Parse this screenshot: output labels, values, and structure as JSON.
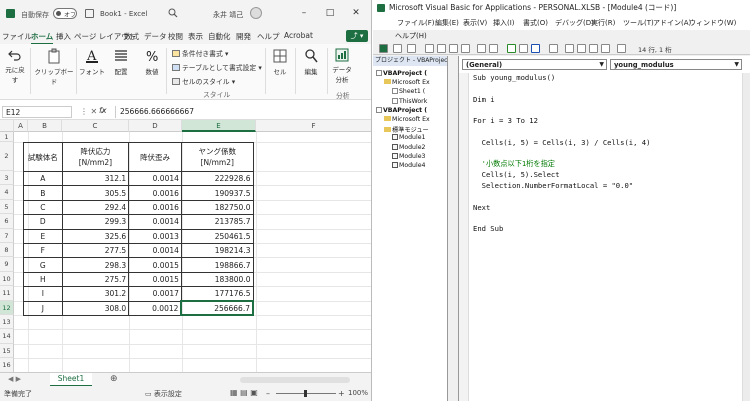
{
  "excel": {
    "autosave_label": "自動保存",
    "autosave_state": "オフ",
    "book_title": "Book1 - Excel",
    "user_name": "永井 靖己",
    "ribbon_tabs": [
      "ファイル",
      "ホーム",
      "挿入",
      "ページ レイアウト",
      "数式",
      "データ",
      "校閲",
      "表示",
      "自動化",
      "開発",
      "ヘルプ",
      "Acrobat"
    ],
    "active_tab": "ホーム",
    "ribbon": {
      "undo": "元に戻す",
      "clipboard": "クリップボード",
      "font": "フォント",
      "alignment": "配置",
      "number": "数値",
      "cond_format": "条件付き書式",
      "table_format": "テーブルとして書式設定",
      "cell_styles": "セルのスタイル",
      "styles_group": "スタイル",
      "cells": "セル",
      "editing": "編集",
      "analyze": "データ分析",
      "analyze_short": "分析"
    },
    "name_box": "E12",
    "formula": "256666.666666667",
    "columns": [
      "A",
      "B",
      "C",
      "D",
      "E",
      "F"
    ],
    "selected_column": "E",
    "row_numbers": [
      "1",
      "2",
      "3",
      "4",
      "5",
      "6",
      "7",
      "8",
      "9",
      "10",
      "11",
      "12",
      "13",
      "14",
      "15",
      "16"
    ],
    "selected_row": "12",
    "table": {
      "headers": [
        [
          "試験体名"
        ],
        [
          "降伏応力",
          "[N/mm2]"
        ],
        [
          "降伏歪み"
        ],
        [
          "ヤング係数",
          "[N/mm2]"
        ]
      ],
      "rows": [
        [
          "A",
          "312.1",
          "0.0014",
          "222928.6"
        ],
        [
          "B",
          "305.5",
          "0.0016",
          "190937.5"
        ],
        [
          "C",
          "292.4",
          "0.0016",
          "182750.0"
        ],
        [
          "D",
          "299.3",
          "0.0014",
          "213785.7"
        ],
        [
          "E",
          "325.6",
          "0.0013",
          "250461.5"
        ],
        [
          "F",
          "277.5",
          "0.0014",
          "198214.3"
        ],
        [
          "G",
          "298.3",
          "0.0015",
          "198866.7"
        ],
        [
          "H",
          "275.7",
          "0.0015",
          "183800.0"
        ],
        [
          "I",
          "301.2",
          "0.0017",
          "177176.5"
        ],
        [
          "J",
          "308.0",
          "0.0012",
          "256666.7"
        ]
      ]
    },
    "sheet_tab": "Sheet1",
    "status_ready": "準備完了",
    "display_settings": "表示設定",
    "zoom": "100%"
  },
  "vbe": {
    "title": "Microsoft Visual Basic for Applications - PERSONAL.XLSB - [Module4 (コード)]",
    "menu": [
      "ファイル(F)",
      "編集(E)",
      "表示(V)",
      "挿入(I)",
      "書式(O)",
      "デバッグ(D)",
      "実行(R)",
      "ツール(T)",
      "アドイン(A)",
      "ウィンドウ(W)",
      "ヘルプ(H)"
    ],
    "position": "14 行, 1 桁",
    "project_title": "プロジェクト - VBAProject",
    "tree": [
      {
        "label": "VBAProject (",
        "level": 0,
        "kind": "proj"
      },
      {
        "label": "Microsoft Ex",
        "level": 1,
        "kind": "folder"
      },
      {
        "label": "Sheet1 (",
        "level": 2,
        "kind": "item"
      },
      {
        "label": "ThisWork",
        "level": 2,
        "kind": "item"
      },
      {
        "label": "VBAProject (",
        "level": 0,
        "kind": "proj"
      },
      {
        "label": "Microsoft Ex",
        "level": 1,
        "kind": "folder"
      },
      {
        "label": "標準モジュー",
        "level": 1,
        "kind": "folder"
      },
      {
        "label": "Module1",
        "level": 2,
        "kind": "module"
      },
      {
        "label": "Module2",
        "level": 2,
        "kind": "module"
      },
      {
        "label": "Module3",
        "level": 2,
        "kind": "module"
      },
      {
        "label": "Module4",
        "level": 2,
        "kind": "module"
      }
    ],
    "combo_object": "(General)",
    "combo_proc": "young_modulus",
    "code": [
      {
        "t": "Sub young_modulus()",
        "c": false
      },
      {
        "t": "",
        "c": false
      },
      {
        "t": "Dim i",
        "c": false
      },
      {
        "t": "",
        "c": false
      },
      {
        "t": "For i = 3 To 12",
        "c": false
      },
      {
        "t": "",
        "c": false
      },
      {
        "t": "  Cells(i, 5) = Cells(i, 3) / Cells(i, 4)",
        "c": false
      },
      {
        "t": "",
        "c": false
      },
      {
        "t": "  '小数点以下1桁を指定",
        "c": true
      },
      {
        "t": "  Cells(i, 5).Select",
        "c": false
      },
      {
        "t": "  Selection.NumberFormatLocal = \"0.0\"",
        "c": false
      },
      {
        "t": "",
        "c": false
      },
      {
        "t": "Next",
        "c": false
      },
      {
        "t": "",
        "c": false
      },
      {
        "t": "End Sub",
        "c": false
      }
    ]
  }
}
